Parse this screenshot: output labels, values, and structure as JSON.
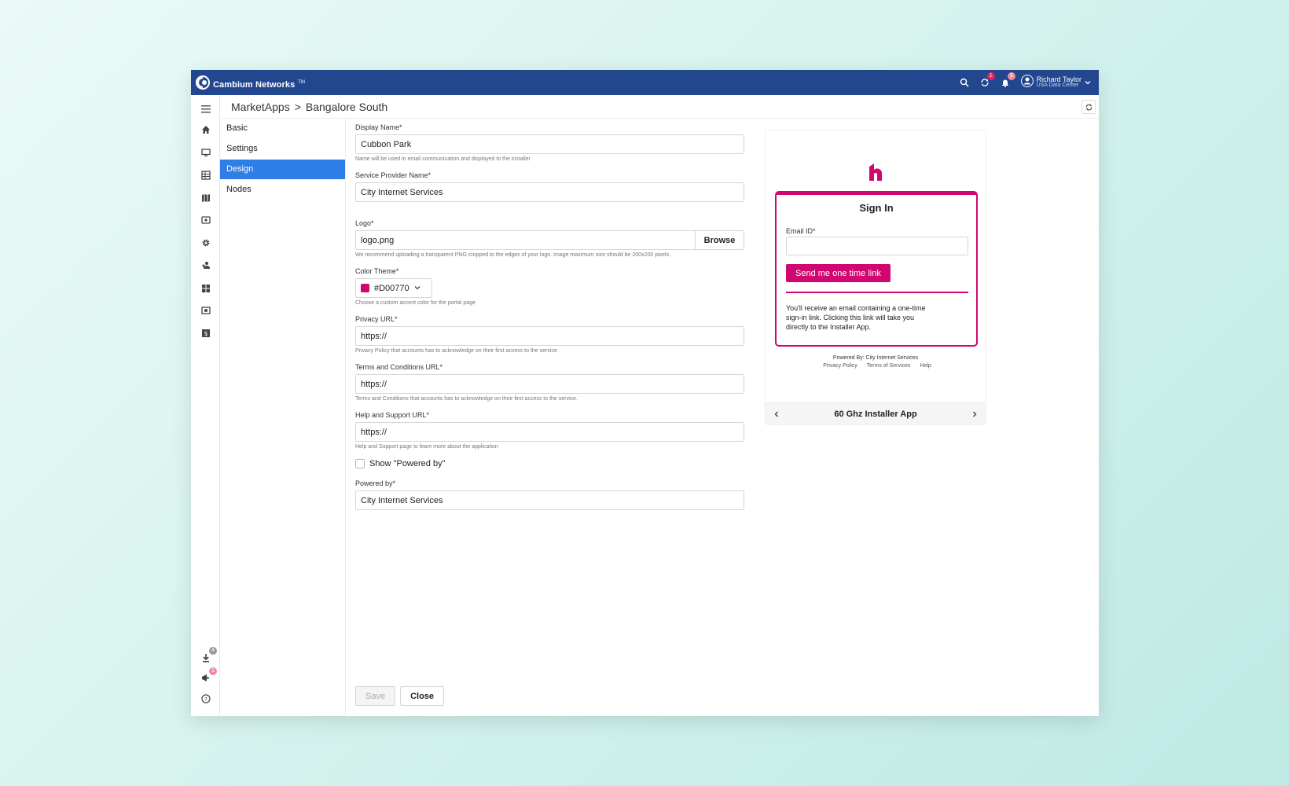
{
  "app": {
    "brand": "Cambium Networks",
    "brand_mark": "TM",
    "notifications": {
      "sync_count": "1",
      "alerts_count": "3"
    },
    "user": {
      "name": "Richard Taylor",
      "datacenter": "USA Data Center"
    }
  },
  "breadcrumb": {
    "parent": "MarketApps",
    "separator": ">",
    "current": "Bangalore South"
  },
  "rail_icons": [
    "menu-icon",
    "home-icon",
    "monitor-icon",
    "table-icon",
    "map-icon",
    "wifi-box-icon",
    "gear-icon",
    "users-icon",
    "apps-icon",
    "camera-icon",
    "dollar-icon"
  ],
  "rail_bottom": {
    "download_count": "4",
    "announce_count": "1"
  },
  "section_nav": [
    {
      "label": "Basic",
      "active": false
    },
    {
      "label": "Settings",
      "active": false
    },
    {
      "label": "Design",
      "active": true
    },
    {
      "label": "Nodes",
      "active": false
    }
  ],
  "form": {
    "display_name": {
      "label": "Display Name*",
      "value": "Cubbon Park",
      "hint": "Name will be used in email communication and displayed to the installer"
    },
    "provider_name": {
      "label": "Service Provider Name*",
      "value": "City Internet Services"
    },
    "logo": {
      "label": "Logo*",
      "value": "logo.png",
      "browse": "Browse",
      "hint": "We recommend uploading a transparent PNG cropped to the edges of your logo. Image maximum size should be 200x200 pixels."
    },
    "color_theme": {
      "label": "Color Theme*",
      "value": "#D00770",
      "hint": "Choose a custom accent color for the portal page"
    },
    "privacy_url": {
      "label": "Privacy URL*",
      "value": "https://",
      "hint": "Privacy Policy that accounts has to acknowledge on their first access to the service."
    },
    "terms_url": {
      "label": "Terms and Conditions URL*",
      "value": "https://",
      "hint": "Terms and Conditions that accounts has to acknowledge on their first access to the service."
    },
    "help_url": {
      "label": "Help and Support URL*",
      "value": "https://",
      "hint": "Help and Support page to learn more about the application"
    },
    "show_powered_by": {
      "label": "Show \"Powered by\""
    },
    "powered_by": {
      "label": "Powered by*",
      "value": "City Internet Services"
    }
  },
  "actions": {
    "save": "Save",
    "close": "Close"
  },
  "preview": {
    "title": "Sign In",
    "email_label": "Email ID*",
    "button": "Send me one time link",
    "note": "You'll receive an email containing a one-time sign-in link. Clicking this link will take you directly to the Installer App.",
    "powered_by": "Powered By: City Internet Services",
    "links": [
      "Privacy Policy",
      "Terms of Services",
      "Help"
    ],
    "app_name": "60 Ghz Installer App"
  },
  "colors": {
    "accent": "#D00770",
    "header": "#23478F",
    "nav_active": "#2F7EE6"
  }
}
